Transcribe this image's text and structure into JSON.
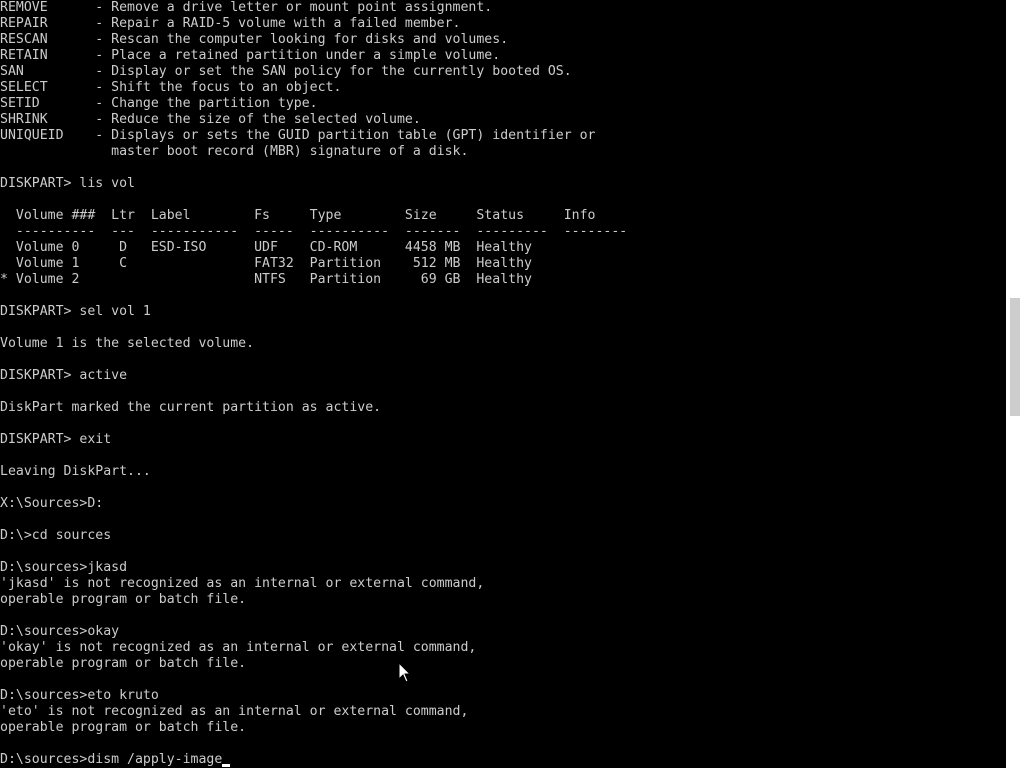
{
  "console": {
    "lines": [
      "REMOVE      - Remove a drive letter or mount point assignment.",
      "REPAIR      - Repair a RAID-5 volume with a failed member.",
      "RESCAN      - Rescan the computer looking for disks and volumes.",
      "RETAIN      - Place a retained partition under a simple volume.",
      "SAN         - Display or set the SAN policy for the currently booted OS.",
      "SELECT      - Shift the focus to an object.",
      "SETID       - Change the partition type.",
      "SHRINK      - Reduce the size of the selected volume.",
      "UNIQUEID    - Displays or sets the GUID partition table (GPT) identifier or",
      "              master boot record (MBR) signature of a disk.",
      "",
      "DISKPART> lis vol",
      "",
      "  Volume ###  Ltr  Label        Fs     Type        Size     Status     Info",
      "  ----------  ---  -----------  -----  ----------  -------  ---------  --------",
      "  Volume 0     D   ESD-ISO      UDF    CD-ROM      4458 MB  Healthy",
      "  Volume 1     C                FAT32  Partition    512 MB  Healthy",
      "* Volume 2                      NTFS   Partition     69 GB  Healthy",
      "",
      "DISKPART> sel vol 1",
      "",
      "Volume 1 is the selected volume.",
      "",
      "DISKPART> active",
      "",
      "DiskPart marked the current partition as active.",
      "",
      "DISKPART> exit",
      "",
      "Leaving DiskPart...",
      "",
      "X:\\Sources>D:",
      "",
      "D:\\>cd sources",
      "",
      "D:\\sources>jkasd",
      "'jkasd' is not recognized as an internal or external command,",
      "operable program or batch file.",
      "",
      "D:\\sources>okay",
      "'okay' is not recognized as an internal or external command,",
      "operable program or batch file.",
      "",
      "D:\\sources>eto kruto",
      "'eto' is not recognized as an internal or external command,",
      "operable program or batch file.",
      ""
    ],
    "input_line": "D:\\sources>dism /apply-image"
  },
  "colors": {
    "background": "#000000",
    "foreground": "#cccccc",
    "scrollbar_track": "#ffffff",
    "scrollbar_thumb": "#cdcdcd"
  },
  "icons": {
    "pointer": "mouse-pointer-icon"
  }
}
